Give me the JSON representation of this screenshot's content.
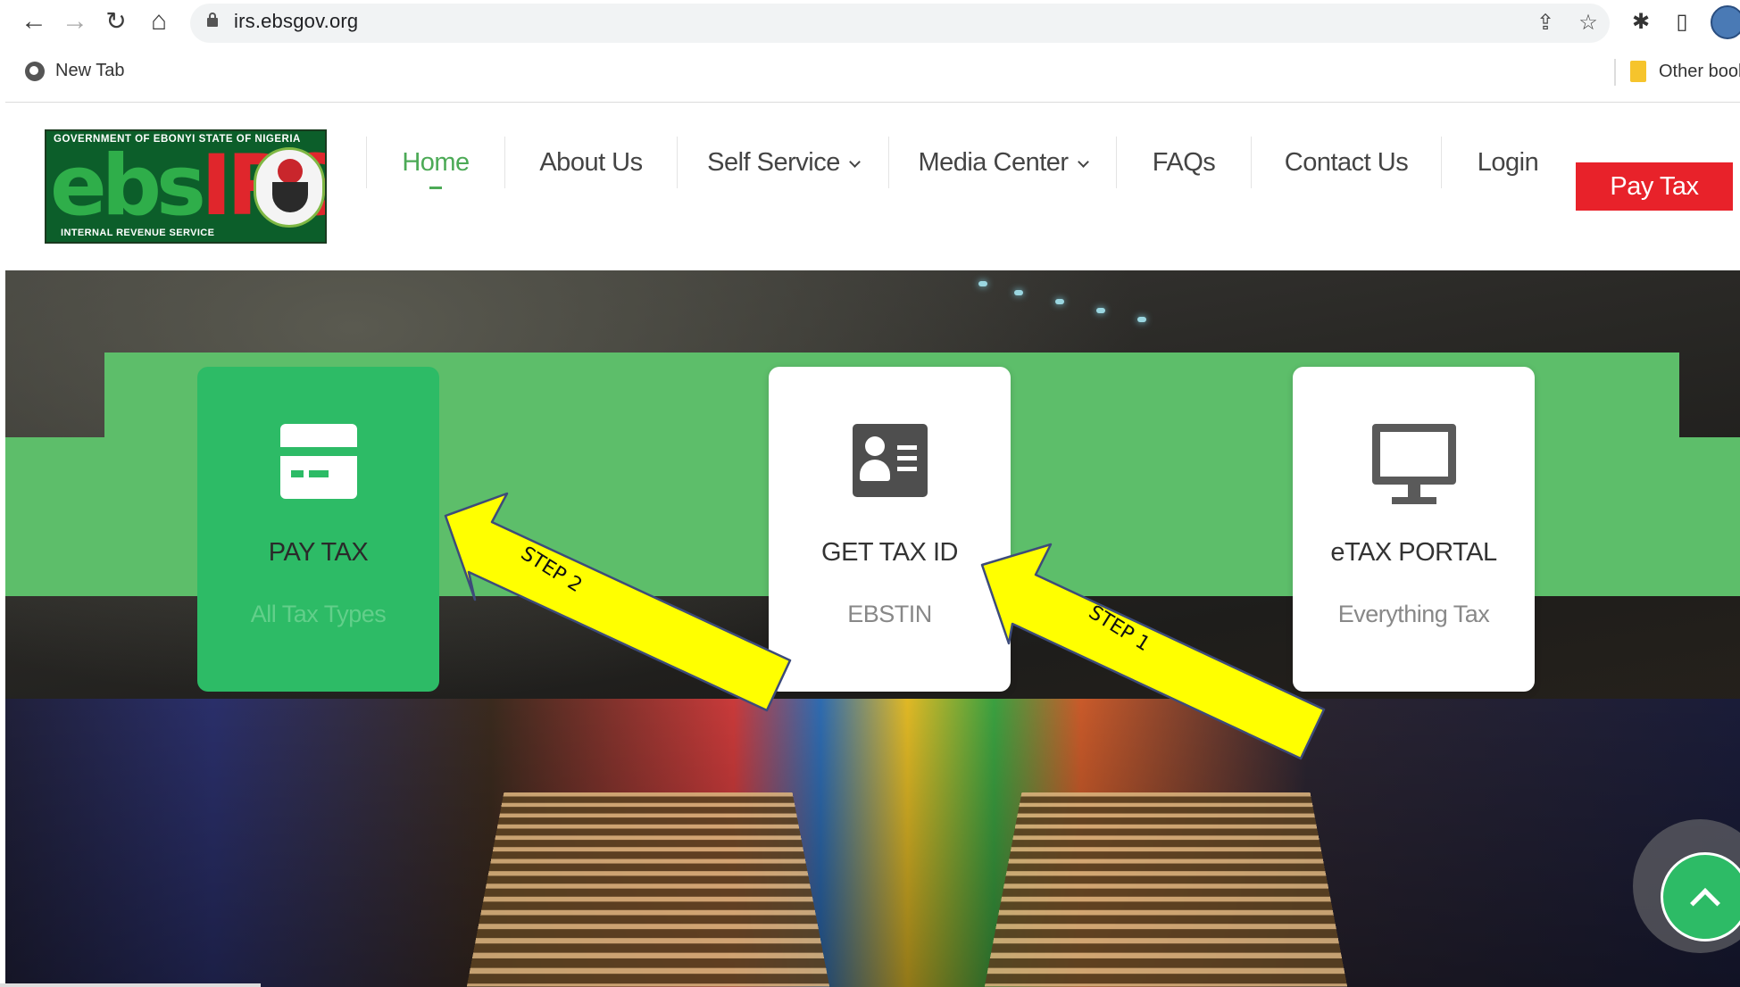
{
  "browser": {
    "url": "irs.ebsgov.org",
    "bookmarks": {
      "new_tab_label": "New Tab",
      "other_bookmarks_label": "Other bool"
    }
  },
  "site": {
    "logo": {
      "top_text": "GOVERNMENT OF EBONYI STATE OF NIGERIA",
      "main_text_green": "ebs",
      "main_text_red": "IRS",
      "bottom_text": "INTERNAL REVENUE SERVICE"
    },
    "nav": {
      "home": "Home",
      "about": "About Us",
      "self_service": "Self Service",
      "media_center": "Media Center",
      "faqs": "FAQs",
      "contact": "Contact Us",
      "login": "Login",
      "pay_tax": "Pay Tax"
    },
    "cards": [
      {
        "title": "PAY TAX",
        "subtitle": "All Tax Types",
        "icon": "credit-card-icon"
      },
      {
        "title": "GET TAX ID",
        "subtitle": "EBSTIN",
        "icon": "id-card-icon"
      },
      {
        "title": "eTAX PORTAL",
        "subtitle": "Everything Tax",
        "icon": "monitor-icon"
      }
    ],
    "annotations": {
      "step1": "STEP 1",
      "step2": "STEP 2"
    }
  },
  "colors": {
    "brand_green": "#5dbe6a",
    "card_active_green": "#2dbb66",
    "pay_tax_red": "#e8222a",
    "arrow_yellow": "#ffff00"
  }
}
